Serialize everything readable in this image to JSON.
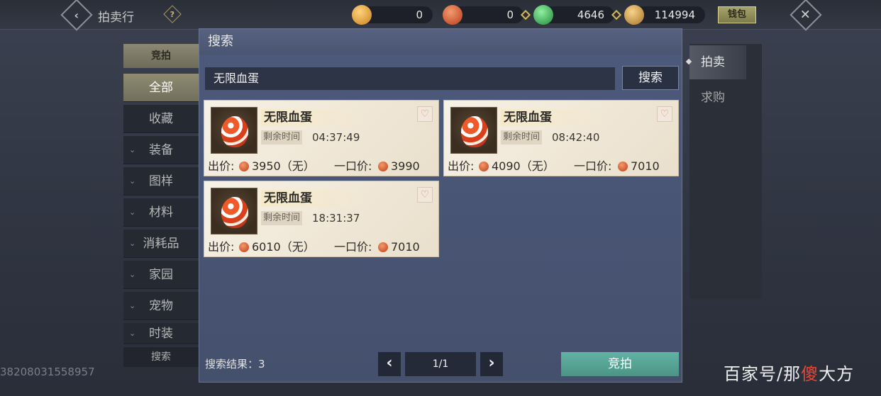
{
  "header": {
    "title": "拍卖行",
    "help_icon": "?",
    "currencies": [
      {
        "name": "gold-token",
        "value": "0",
        "color": "#e3a23a"
      },
      {
        "name": "red-coin",
        "value": "0",
        "color": "#d2572b"
      },
      {
        "name": "jade-coin",
        "value": "4646",
        "color": "#3fae57"
      },
      {
        "name": "gold-leaf",
        "value": "114994",
        "color": "#d9a64b"
      }
    ],
    "wallet_label": "钱包"
  },
  "sidebar": {
    "header": "竞拍",
    "items": [
      {
        "label": "全部",
        "active": true,
        "chevron": ""
      },
      {
        "label": "收藏",
        "active": false,
        "chevron": ""
      },
      {
        "label": "装备",
        "active": false,
        "chevron": "⌄"
      },
      {
        "label": "图样",
        "active": false,
        "chevron": "⌄"
      },
      {
        "label": "材料",
        "active": false,
        "chevron": "⌄"
      },
      {
        "label": "消耗品",
        "active": false,
        "chevron": "⌄"
      },
      {
        "label": "家园",
        "active": false,
        "chevron": "⌄"
      },
      {
        "label": "宠物",
        "active": false,
        "chevron": "⌄"
      },
      {
        "label": "时装",
        "active": false,
        "chevron": "⌄"
      }
    ],
    "search_label": "搜索",
    "id_text": "38208031558957"
  },
  "right_tabs": [
    {
      "label": "拍卖",
      "active": true
    },
    {
      "label": "求购",
      "active": false
    }
  ],
  "dialog": {
    "title": "搜索",
    "search_value": "无限血蛋",
    "search_button": "搜索",
    "results": [
      {
        "name": "无限血蛋",
        "time_label": "剩余时间",
        "time": "04:37:49",
        "bid_label": "出价:",
        "bid": "3950（无）",
        "buyout_label": "一口价:",
        "buyout": "3990"
      },
      {
        "name": "无限血蛋",
        "time_label": "剩余时间",
        "time": "08:42:40",
        "bid_label": "出价:",
        "bid": "4090（无）",
        "buyout_label": "一口价:",
        "buyout": "7010"
      },
      {
        "name": "无限血蛋",
        "time_label": "剩余时间",
        "time": "18:31:37",
        "bid_label": "出价:",
        "bid": "6010（无）",
        "buyout_label": "一口价:",
        "buyout": "7010"
      }
    ],
    "result_count_label": "搜索结果：3",
    "page": "1/1",
    "bid_button": "竞拍"
  },
  "watermark": {
    "prefix": "百家号/那",
    "accent": "傻",
    "suffix": "大方"
  }
}
